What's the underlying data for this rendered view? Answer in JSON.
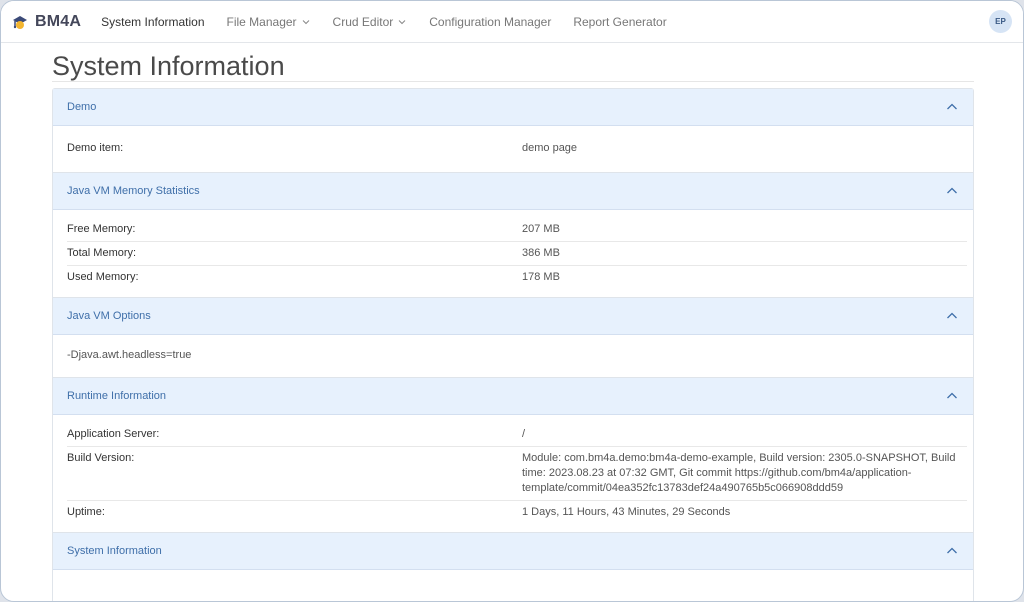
{
  "brand": {
    "name": "BM4A"
  },
  "nav": {
    "items": [
      {
        "label": "System Information",
        "active": true,
        "dropdown": false
      },
      {
        "label": "File Manager",
        "active": false,
        "dropdown": true
      },
      {
        "label": "Crud Editor",
        "active": false,
        "dropdown": true
      },
      {
        "label": "Configuration Manager",
        "active": false,
        "dropdown": false
      },
      {
        "label": "Report Generator",
        "active": false,
        "dropdown": false
      }
    ],
    "avatar": "EP"
  },
  "page": {
    "title": "System Information"
  },
  "sections": {
    "demo": {
      "title": "Demo",
      "rows": [
        {
          "key": "Demo item:",
          "value": "demo page"
        }
      ]
    },
    "memory": {
      "title": "Java VM Memory Statistics",
      "rows": [
        {
          "key": "Free Memory:",
          "value": "207 MB"
        },
        {
          "key": "Total Memory:",
          "value": "386 MB"
        },
        {
          "key": "Used Memory:",
          "value": "178 MB"
        }
      ]
    },
    "options": {
      "title": "Java VM Options",
      "text": "-Djava.awt.headless=true"
    },
    "runtime": {
      "title": "Runtime Information",
      "rows": [
        {
          "key": "Application Server:",
          "value": "/"
        },
        {
          "key": "Build Version:",
          "value": "Module: com.bm4a.demo:bm4a-demo-example, Build version: 2305.0-SNAPSHOT, Build time: 2023.08.23 at 07:32 GMT, Git commit https://github.com/bm4a/application-template/commit/04ea352fc13783def24a490765b5c066908ddd59"
        },
        {
          "key": "Uptime:",
          "value": "1 Days, 11 Hours, 43 Minutes, 29 Seconds"
        }
      ]
    },
    "system": {
      "title": "System Information"
    }
  },
  "colors": {
    "accent": "#3f6fa9",
    "header_bg": "#e7f1fd"
  },
  "icons": {
    "collapse": "chevron-up-icon",
    "dropdown": "chevron-down-icon",
    "logo": "bm4a-logo-icon"
  }
}
